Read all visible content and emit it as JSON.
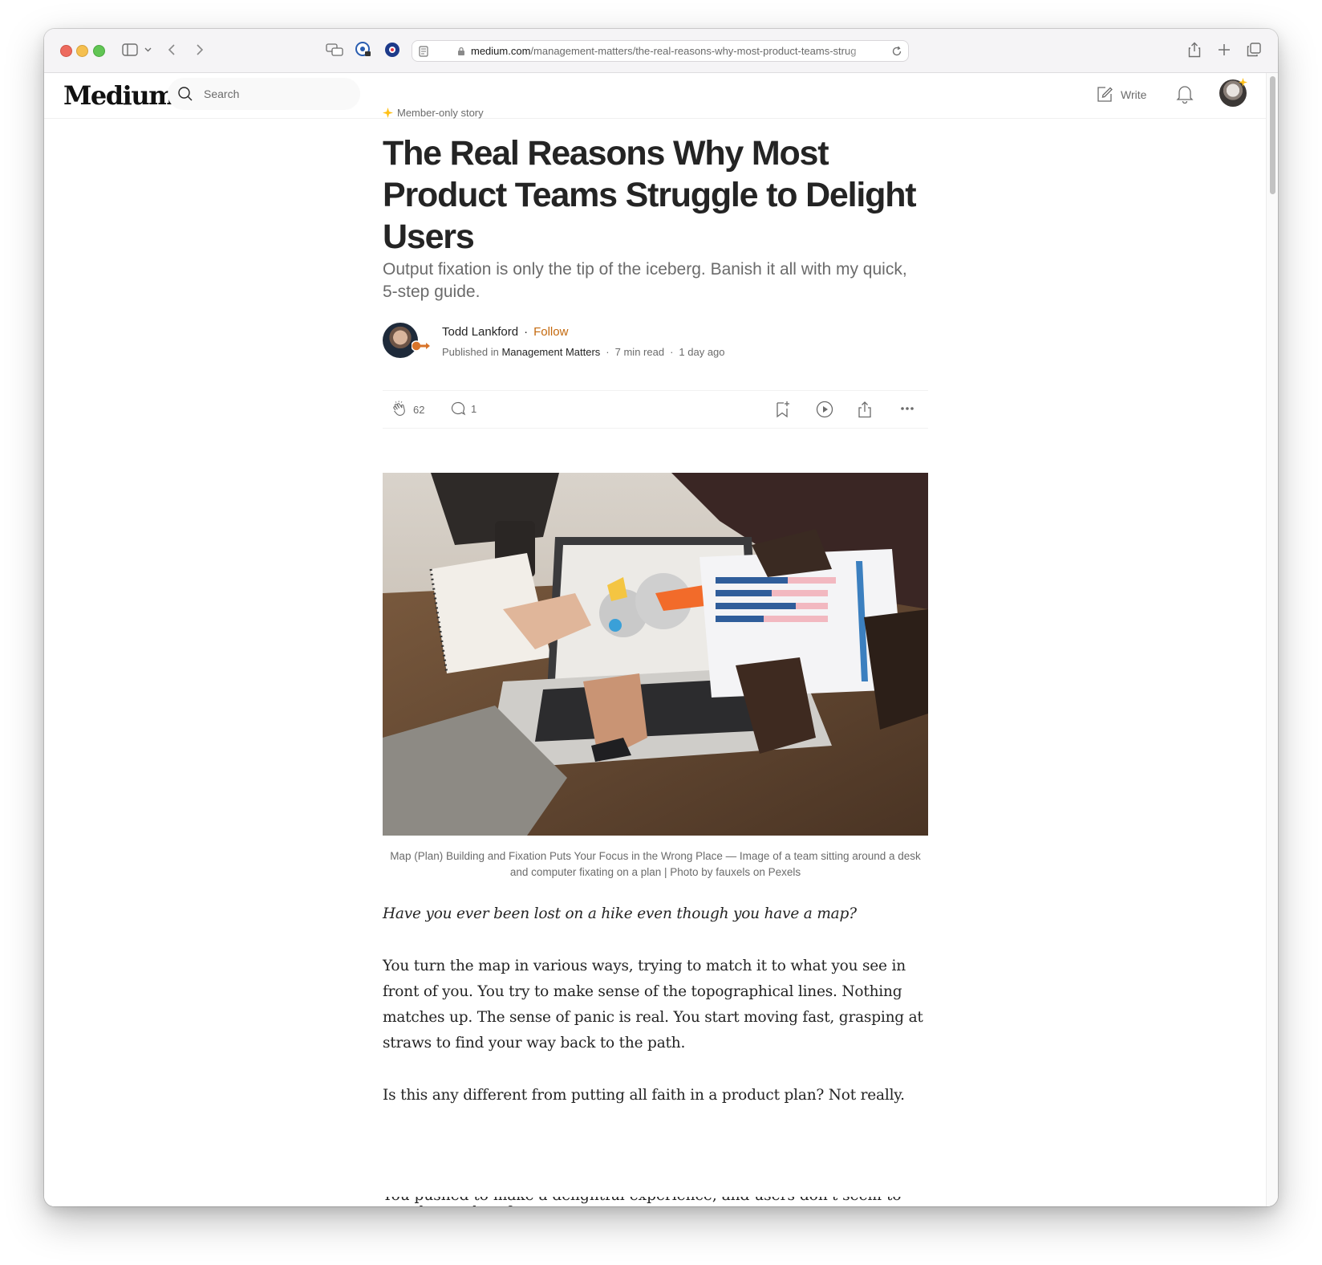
{
  "browser": {
    "url_domain": "medium.com",
    "url_path": "/management-matters/the-real-reasons-why-most-product-teams-strug"
  },
  "header": {
    "logo": "Medium",
    "search_placeholder": "Search",
    "write_label": "Write"
  },
  "article": {
    "badge": "Member-only story",
    "title": "The Real Reasons Why Most Product Teams Struggle to Delight Users",
    "subtitle": "Output fixation is only the tip of the iceberg. Banish it all with my quick, 5-step guide.",
    "author": "Todd Lankford",
    "follow_label": "Follow",
    "published_prefix": "Published in",
    "publication": "Management Matters",
    "read_time": "7 min read",
    "published_ago": "1 day ago",
    "claps": "62",
    "responses": "1",
    "caption": "Map (Plan) Building and Fixation Puts Your Focus in the Wrong Place — Image of a team sitting around a desk and computer fixating on a plan | Photo by fauxels on Pexels",
    "paragraphs": [
      "Have you ever been lost on a hike even though you have a map?",
      "You turn the map in various ways, trying to match it to what you see in front of you. You try to make sense of the topographical lines. Nothing matches up. The sense of panic is real. You start moving fast, grasping at straws to find your way back to the path.",
      "Is this any different from putting all faith in a product plan? Not really."
    ],
    "cut_off_line": "You pushed to make a delightful experience, and users don't seem to use the product features."
  },
  "colors": {
    "follow": "#c4690e",
    "member_star": "#ffc017"
  }
}
